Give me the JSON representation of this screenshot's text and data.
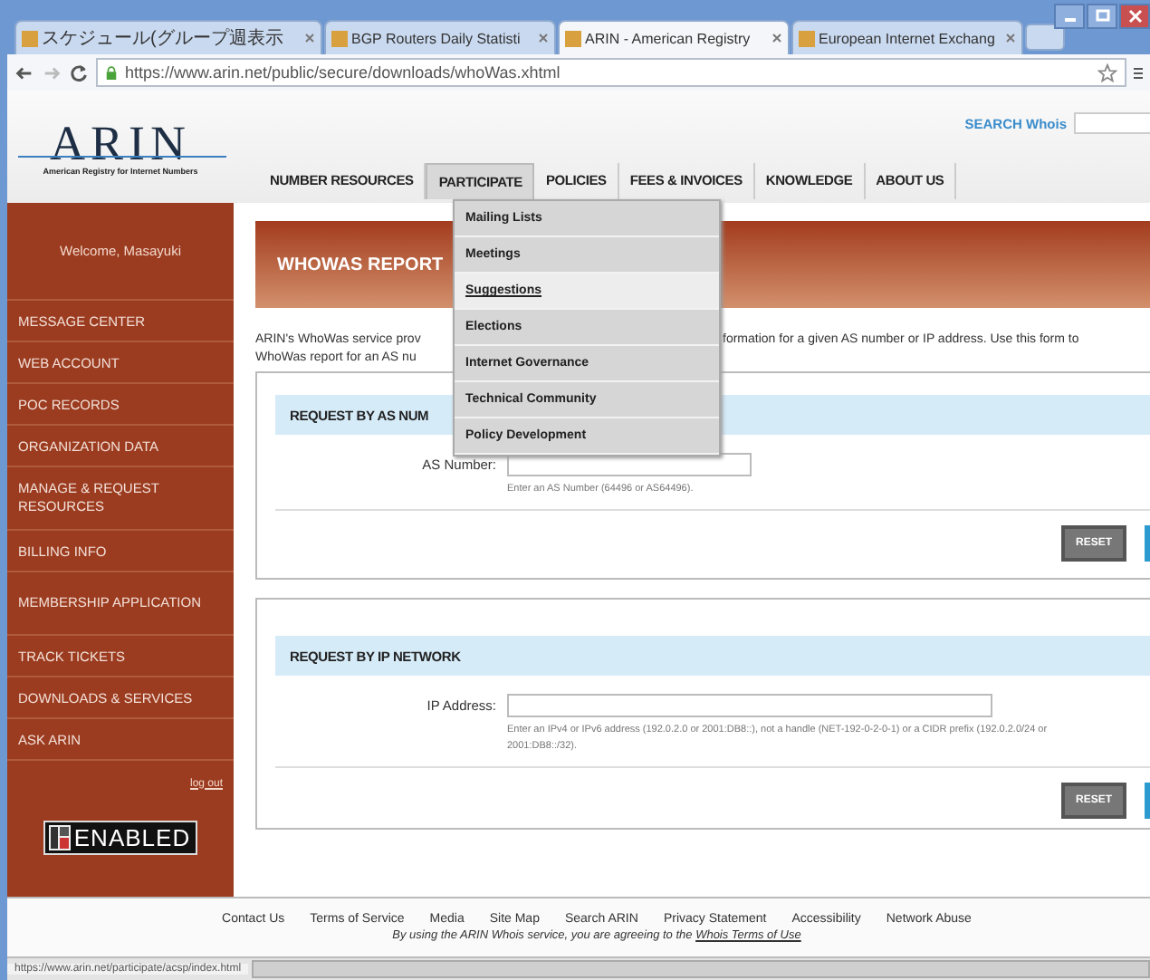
{
  "browser": {
    "tabs": [
      {
        "title": "スケジュール(グループ週表示",
        "selected": false
      },
      {
        "title": "BGP Routers Daily Statisti",
        "selected": false
      },
      {
        "title": "ARIN - American Registry",
        "selected": true
      },
      {
        "title": "European Internet Exchang",
        "selected": false
      }
    ],
    "url": "https://www.arin.net/public/secure/downloads/whoWas.xhtml",
    "status_url": "https://www.arin.net/participate/acsp/index.html"
  },
  "header": {
    "logo": "ARIN",
    "logo_tagline": "American Registry for Internet Numbers",
    "search_label": "SEARCH Whois",
    "nav": [
      {
        "label": "NUMBER RESOURCES",
        "selected": false
      },
      {
        "label": "PARTICIPATE",
        "selected": true
      },
      {
        "label": "POLICIES",
        "selected": false
      },
      {
        "label": "FEES & INVOICES",
        "selected": false
      },
      {
        "label": "KNOWLEDGE",
        "selected": false
      },
      {
        "label": "ABOUT US",
        "selected": false
      }
    ],
    "dropdown": [
      {
        "label": "Mailing Lists",
        "selected": false
      },
      {
        "label": "Meetings",
        "selected": false
      },
      {
        "label": "Suggestions",
        "selected": true
      },
      {
        "label": "Elections",
        "selected": false
      },
      {
        "label": "Internet Governance",
        "selected": false
      },
      {
        "label": "Technical Community",
        "selected": false
      },
      {
        "label": "Policy Development",
        "selected": false
      }
    ]
  },
  "sidebar": {
    "welcome": "Welcome, Masayuki",
    "items": [
      "MESSAGE CENTER",
      "WEB ACCOUNT",
      "POC RECORDS",
      "ORGANIZATION DATA",
      "MANAGE & REQUEST RESOURCES",
      "BILLING INFO",
      "MEMBERSHIP APPLICATION",
      "TRACK TICKETS",
      "DOWNLOADS & SERVICES",
      "ASK ARIN"
    ],
    "logout": "log out",
    "badge": "ENABLED"
  },
  "content": {
    "title": "WHOWAS REPORT",
    "intro_line1_left": "ARIN's WhoWas service prov",
    "intro_line1_right": "formation for a given AS number or IP address. Use this form to",
    "intro_line2_left": "WhoWas report for an AS nu",
    "forms": [
      {
        "heading": "REQUEST BY AS NUM",
        "label": "AS Number:",
        "hint": "Enter an AS Number (64496 or AS64496).",
        "reset": "RESET"
      },
      {
        "heading": "REQUEST BY IP NETWORK",
        "label": "IP Address:",
        "hint": "Enter an IPv4 or IPv6 address (192.0.2.0 or 2001:DB8::), not a handle (NET-192-0-2-0-1) or a CIDR prefix (192.0.2.0/24 or 2001:DB8::/32).",
        "reset": "RESET"
      }
    ]
  },
  "footer": {
    "links": [
      "Contact Us",
      "Terms of Service",
      "Media",
      "Site Map",
      "Search ARIN",
      "Privacy Statement",
      "Accessibility",
      "Network Abuse"
    ],
    "notice": "By using the ARIN Whois service, you are agreeing to the ",
    "notice_link": "Whois Terms of Use"
  }
}
